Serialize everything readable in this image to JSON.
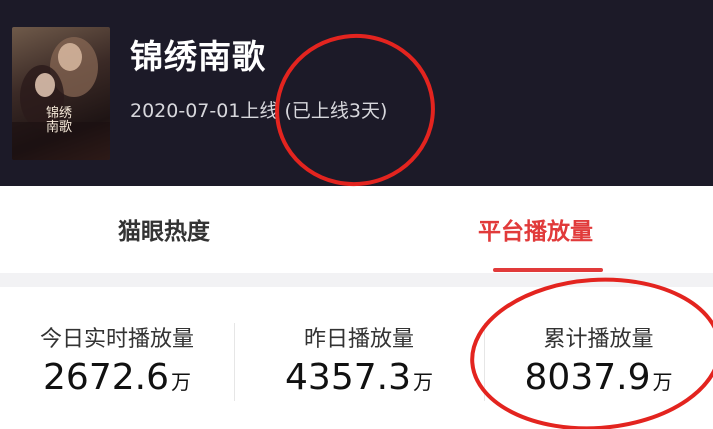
{
  "header": {
    "title": "锦绣南歌",
    "release_text": "2020-07-01上线 (已上线3天)",
    "poster_text": "锦绣南歌"
  },
  "tabs": [
    {
      "label": "猫眼热度",
      "active": false
    },
    {
      "label": "平台播放量",
      "active": true
    }
  ],
  "stats": [
    {
      "label": "今日实时播放量",
      "value": "2672.6",
      "unit": "万"
    },
    {
      "label": "昨日播放量",
      "value": "4357.3",
      "unit": "万"
    },
    {
      "label": "累计播放量",
      "value": "8037.9",
      "unit": "万"
    }
  ],
  "colors": {
    "header_bg": "#1c1a28",
    "accent": "#e13a3a",
    "annotation": "#e3241f"
  }
}
